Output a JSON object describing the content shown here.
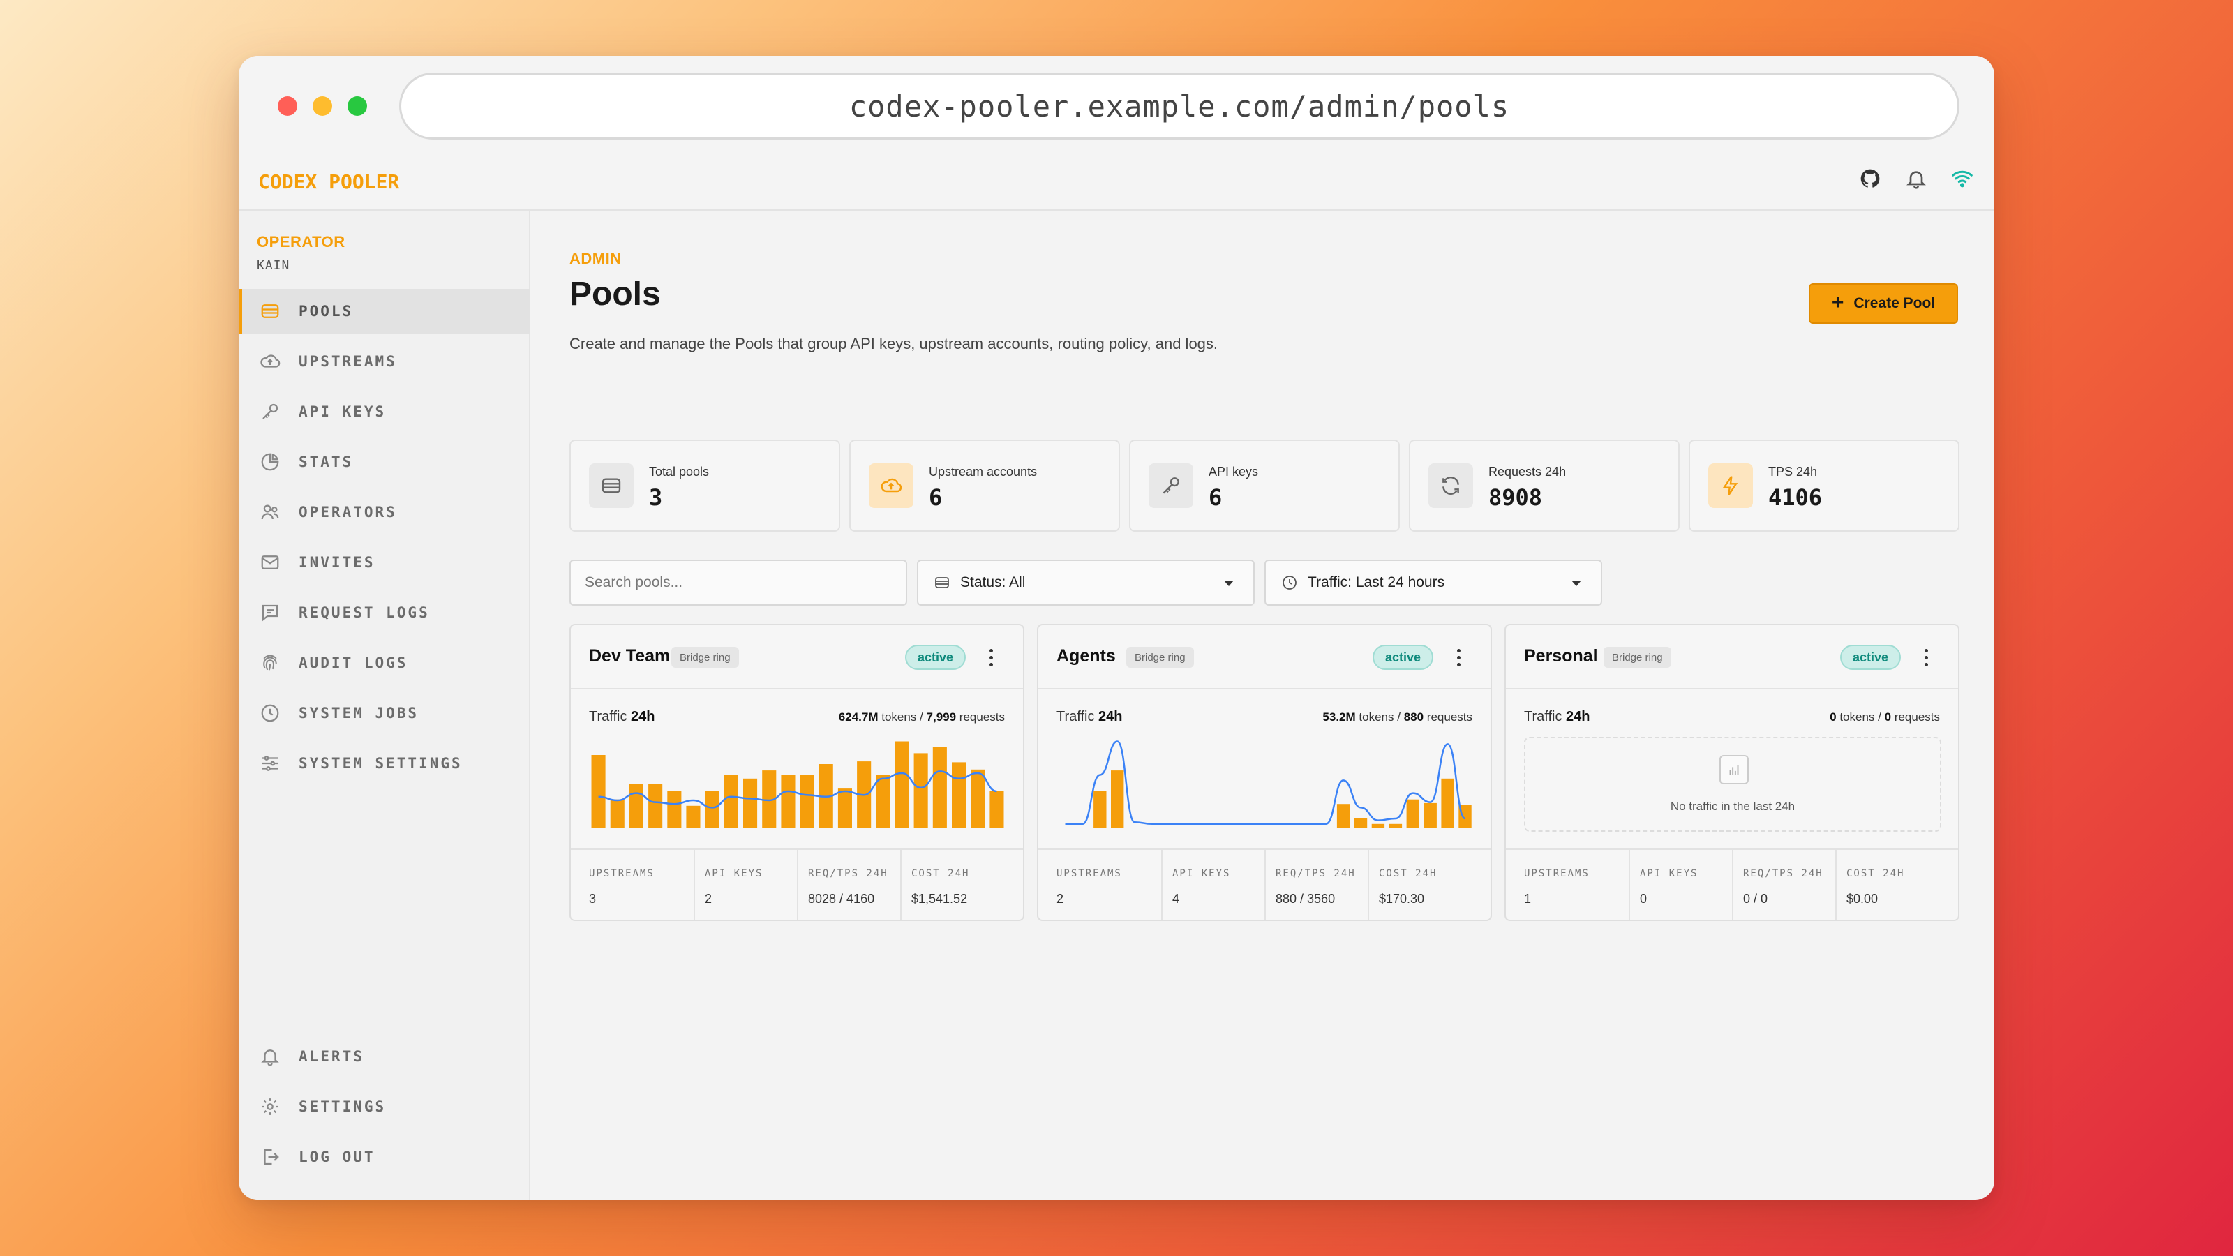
{
  "browser": {
    "url": "codex-pooler.example.com/admin/pools"
  },
  "app": {
    "brand": "CODEX POOLER"
  },
  "operator": {
    "role": "OPERATOR",
    "name": "KAIN"
  },
  "sidebar": {
    "items": [
      {
        "label": "POOLS",
        "icon": "pools-icon"
      },
      {
        "label": "UPSTREAMS",
        "icon": "cloud-upload-icon"
      },
      {
        "label": "API KEYS",
        "icon": "key-icon"
      },
      {
        "label": "STATS",
        "icon": "pie-chart-icon"
      },
      {
        "label": "OPERATORS",
        "icon": "users-icon"
      },
      {
        "label": "INVITES",
        "icon": "mail-icon"
      },
      {
        "label": "REQUEST LOGS",
        "icon": "message-icon"
      },
      {
        "label": "AUDIT LOGS",
        "icon": "fingerprint-icon"
      },
      {
        "label": "SYSTEM JOBS",
        "icon": "clock-icon"
      },
      {
        "label": "SYSTEM SETTINGS",
        "icon": "sliders-icon"
      }
    ],
    "bottom_items": [
      {
        "label": "ALERTS",
        "icon": "bell-icon"
      },
      {
        "label": "SETTINGS",
        "icon": "gear-icon"
      },
      {
        "label": "LOG OUT",
        "icon": "logout-icon"
      }
    ],
    "active": "POOLS"
  },
  "page": {
    "eyebrow": "ADMIN",
    "title": "Pools",
    "description": "Create and manage the Pools that group API keys, upstream accounts, routing policy, and logs.",
    "create_button": "Create Pool"
  },
  "stats": [
    {
      "label": "Total pools",
      "value": "3",
      "icon": "pools-icon"
    },
    {
      "label": "Upstream accounts",
      "value": "6",
      "icon": "cloud-upload-icon"
    },
    {
      "label": "API keys",
      "value": "6",
      "icon": "key-icon"
    },
    {
      "label": "Requests 24h",
      "value": "8908",
      "icon": "refresh-icon"
    },
    {
      "label": "TPS 24h",
      "value": "4106",
      "icon": "bolt-icon"
    }
  ],
  "filters": {
    "search_placeholder": "Search pools...",
    "status": "Status: All",
    "traffic": "Traffic: Last 24 hours"
  },
  "pools": [
    {
      "name": "Dev Team",
      "ring": "Bridge ring",
      "status": "active",
      "traffic_label": "Traffic",
      "traffic_window": "24h",
      "tokens": "624.7M",
      "tokens_suffix": "tokens /",
      "requests": "7,999",
      "requests_suffix": "requests",
      "footer": [
        {
          "key": "UPSTREAMS",
          "value": "3"
        },
        {
          "key": "API KEYS",
          "value": "2"
        },
        {
          "key": "REQ/TPS 24H",
          "value": "8028 / 4160"
        },
        {
          "key": "COST 24H",
          "value": "$1,541.52"
        }
      ]
    },
    {
      "name": "Agents",
      "ring": "Bridge ring",
      "status": "active",
      "traffic_label": "Traffic",
      "traffic_window": "24h",
      "tokens": "53.2M",
      "tokens_suffix": "tokens /",
      "requests": "880",
      "requests_suffix": "requests",
      "footer": [
        {
          "key": "UPSTREAMS",
          "value": "2"
        },
        {
          "key": "API KEYS",
          "value": "4"
        },
        {
          "key": "REQ/TPS 24H",
          "value": "880 / 3560"
        },
        {
          "key": "COST 24H",
          "value": "$170.30"
        }
      ]
    },
    {
      "name": "Personal",
      "ring": "Bridge ring",
      "status": "active",
      "traffic_label": "Traffic",
      "traffic_window": "24h",
      "tokens": "0",
      "tokens_suffix": "tokens /",
      "requests": "0",
      "requests_suffix": "requests",
      "empty_text": "No traffic in the last 24h",
      "footer": [
        {
          "key": "UPSTREAMS",
          "value": "1"
        },
        {
          "key": "API KEYS",
          "value": "0"
        },
        {
          "key": "REQ/TPS 24H",
          "value": "0 / 0"
        },
        {
          "key": "COST 24H",
          "value": "$0.00"
        }
      ]
    }
  ],
  "colors": {
    "accent": "#f59e0b",
    "line": "#3b82f6",
    "active_badge": "#0f8a7c"
  },
  "chart_data": [
    {
      "type": "bar",
      "pool": "Dev Team",
      "values": [
        0.8,
        0.31,
        0.48,
        0.48,
        0.4,
        0.24,
        0.4,
        0.58,
        0.54,
        0.63,
        0.58,
        0.58,
        0.7,
        0.43,
        0.73,
        0.58,
        0.95,
        0.82,
        0.89,
        0.72,
        0.64,
        0.4
      ],
      "line": [
        0.34,
        0.3,
        0.38,
        0.28,
        0.26,
        0.3,
        0.22,
        0.34,
        0.32,
        0.3,
        0.4,
        0.36,
        0.34,
        0.4,
        0.36,
        0.54,
        0.6,
        0.44,
        0.62,
        0.54,
        0.6,
        0.4
      ]
    },
    {
      "type": "bar",
      "pool": "Agents",
      "values": [
        0,
        0,
        0.4,
        0.63,
        0,
        0,
        0,
        0,
        0,
        0,
        0,
        0,
        0,
        0,
        0,
        0,
        0.26,
        0.1,
        0.04,
        0.04,
        0.31,
        0.27,
        0.54,
        0.25
      ],
      "line": [
        0.04,
        0.04,
        0.58,
        0.95,
        0.06,
        0.04,
        0.04,
        0.04,
        0.04,
        0.04,
        0.04,
        0.04,
        0.04,
        0.04,
        0.04,
        0.04,
        0.52,
        0.22,
        0.08,
        0.1,
        0.38,
        0.28,
        0.92,
        0.1
      ]
    }
  ]
}
